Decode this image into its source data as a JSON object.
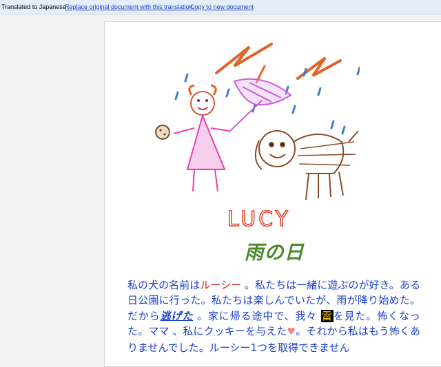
{
  "toolbar": {
    "status": "Translated to Japanese",
    "replace_link": "Replace original document with this translation",
    "copy_link": "Copy to new document"
  },
  "drawing": {
    "caption": "LUCY",
    "colors": {
      "lightning": "#e0642a",
      "rain": "#3b7fc8",
      "girl": "#e83fb0",
      "girl_face": "#d6552a",
      "umbrella": "#cc5ad8",
      "dog": "#8a4a2a",
      "caption": "#e0452a"
    }
  },
  "document": {
    "title": "雨の日",
    "story": {
      "s1": "私の犬の名前は",
      "dog_name": "ルーシー",
      "s2": "。私たちは一緒に遊ぶのが好き。ある日公園に行った。私たちは楽しんでいたが、雨が降り始めた。だから",
      "fled": "逃げた",
      "s3": "。家に帰る途中で、我々",
      "thunder": "雷",
      "s4": "を見た。怖くなった。ママ 、私にクッキーを与えた",
      "heart": "♥",
      "s5": "。それから私はもう怖くありませんでした。ルーシー1つを取得できません"
    }
  }
}
